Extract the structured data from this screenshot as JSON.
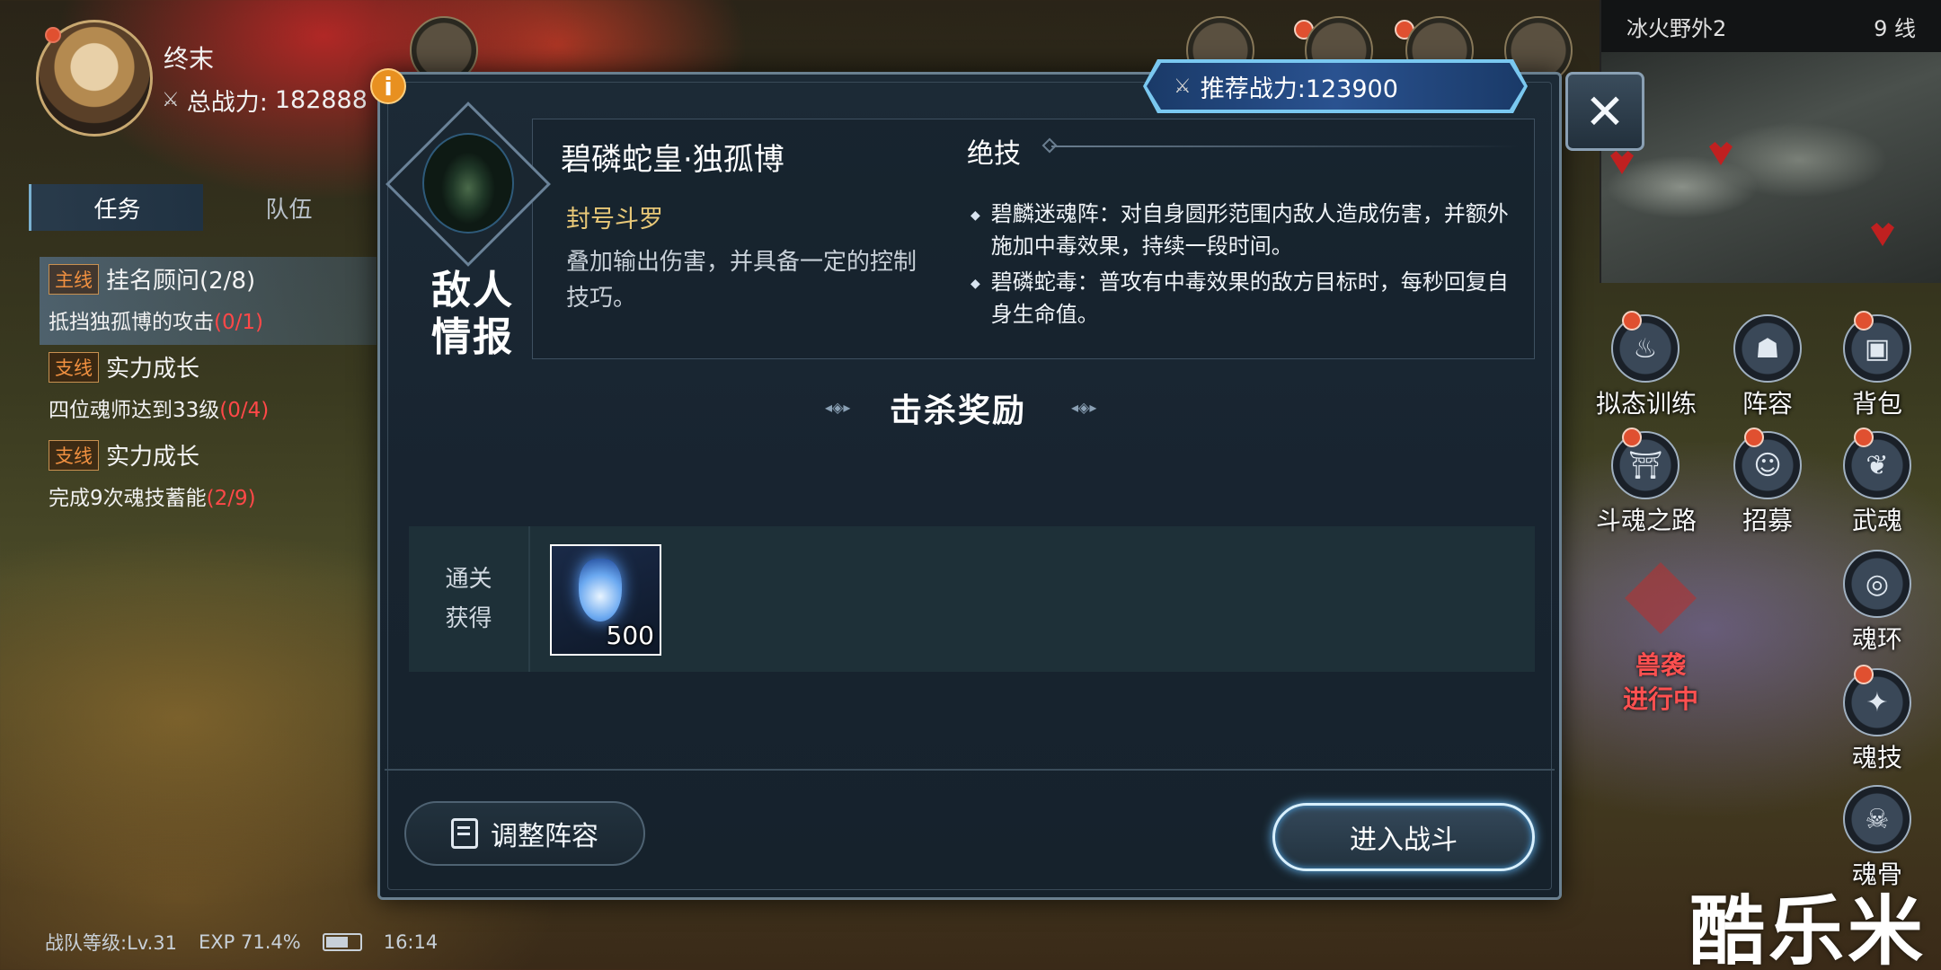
{
  "player": {
    "name": "终末",
    "power_label": "总战力:",
    "power_value": "182888"
  },
  "quest_tabs": [
    "任务",
    "队伍"
  ],
  "quests": [
    {
      "tag": "主线",
      "title": "挂名顾问(2/8)",
      "desc": "抵挡独孤博的攻击",
      "progress": "(0/1)"
    },
    {
      "tag": "支线",
      "title": "实力成长",
      "desc": "四位魂师达到33级",
      "progress": "(0/4)"
    },
    {
      "tag": "支线",
      "title": "实力成长",
      "desc": "完成9次魂技蓄能",
      "progress": "(2/9)"
    }
  ],
  "minimap": {
    "area": "冰火野外2",
    "line": "9 线"
  },
  "side_buttons": [
    "拟态训练",
    "阵容",
    "背包",
    "斗魂之路",
    "招募",
    "武魂",
    "魂环",
    "魂技",
    "魂骨"
  ],
  "beast_status": {
    "line1": "兽袭",
    "line2": "进行中"
  },
  "dialog": {
    "recommended_power": "推荐战力:123900",
    "enemy_label": "敌人情报",
    "enemy_name": "碧磷蛇皇·独孤博",
    "enemy_title": "封号斗罗",
    "enemy_desc": "叠加输出伤害，并具备一定的控制技巧。",
    "skills_heading": "绝技",
    "skills": [
      "碧麟迷魂阵：对自身圆形范围内敌人造成伤害，并额外施加中毒效果，持续一段时间。",
      "碧磷蛇毒：普攻有中毒效果的敌方目标时，每秒回复自身生命值。"
    ],
    "reward_title": "击杀奖励",
    "reward_label_line1": "通关",
    "reward_label_line2": "获得",
    "reward_item": {
      "icon": "soul-potion-icon",
      "count": "500"
    },
    "adjust_button": "调整阵容",
    "battle_button": "进入战斗"
  },
  "status_bar": {
    "team_level": "战队等级:Lv.31",
    "exp": "EXP 71.4%",
    "time": "16:14"
  },
  "watermark": "酷乐米",
  "colors": {
    "accent_orange": "#e89020",
    "alert_red": "#ff4848",
    "title_gold": "#e8c878",
    "glow_blue": "#6ac0ff"
  }
}
